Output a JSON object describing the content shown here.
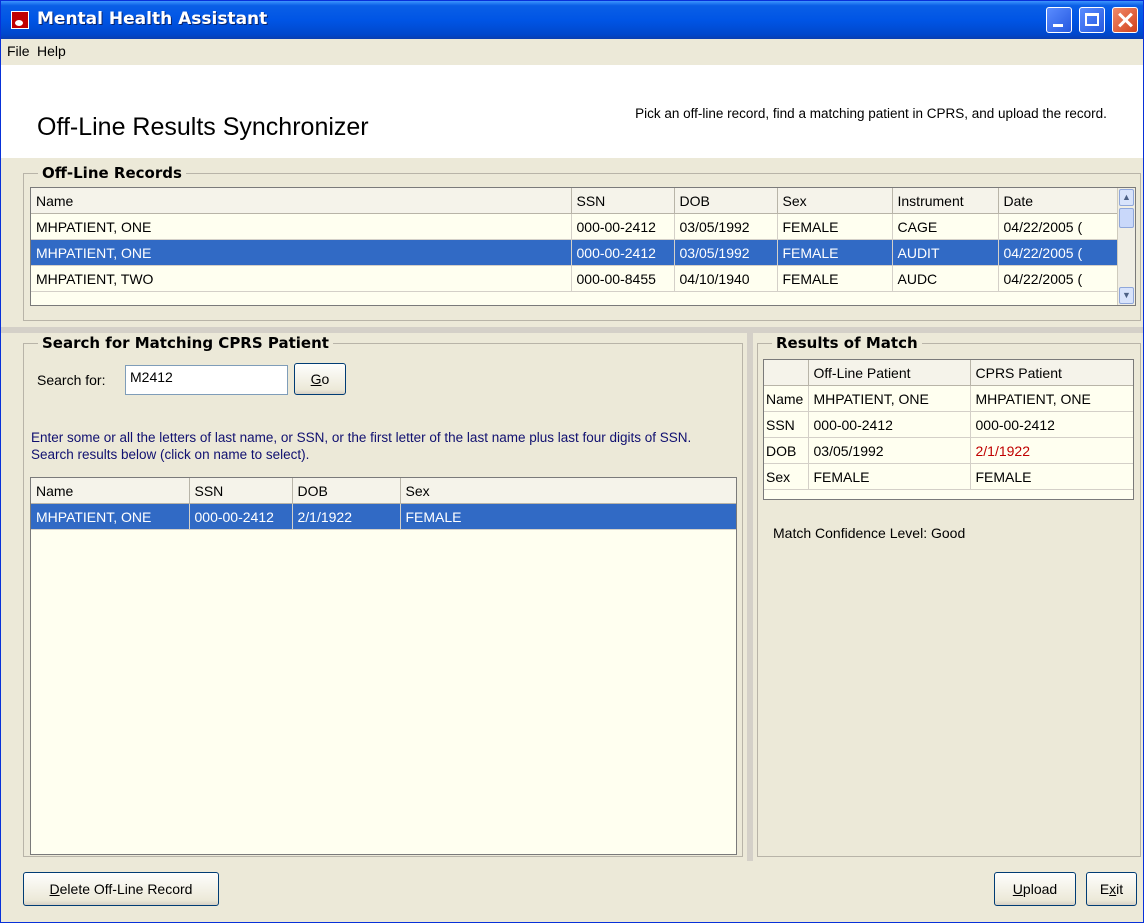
{
  "window": {
    "title": "Mental Health Assistant"
  },
  "menu": [
    "File",
    "Help"
  ],
  "header": {
    "title": "Off-Line Results Synchronizer",
    "instructions": "Pick an off-line record, find a matching patient in CPRS, and upload the record."
  },
  "offline": {
    "group_label": "Off-Line Records",
    "columns": [
      "Name",
      "SSN",
      "DOB",
      "Sex",
      "Instrument",
      "Date"
    ],
    "rows": [
      {
        "name": "MHPATIENT, ONE",
        "ssn": "000-00-2412",
        "dob": "03/05/1992",
        "sex": "FEMALE",
        "instrument": "CAGE",
        "date": "04/22/2005 ("
      },
      {
        "name": "MHPATIENT, ONE",
        "ssn": "000-00-2412",
        "dob": "03/05/1992",
        "sex": "FEMALE",
        "instrument": "AUDIT",
        "date": "04/22/2005 ("
      },
      {
        "name": "MHPATIENT, TWO",
        "ssn": "000-00-8455",
        "dob": "04/10/1940",
        "sex": "FEMALE",
        "instrument": "AUDC",
        "date": "04/22/2005 ("
      }
    ],
    "selected_index": 1
  },
  "search": {
    "group_label": "Search for Matching CPRS Patient",
    "label": "Search for:",
    "value": "M2412",
    "go_label": "Go",
    "go_hotkey": "G",
    "go_rest": "o",
    "help": "Enter some or all the letters of last name, or SSN, or the first letter of the last name plus last four digits of SSN. Search results below (click on name to select).",
    "columns": [
      "Name",
      "SSN",
      "DOB",
      "Sex"
    ],
    "results": [
      {
        "name": "MHPATIENT, ONE",
        "ssn": "000-00-2412",
        "dob": "2/1/1922",
        "sex": "FEMALE"
      }
    ]
  },
  "match": {
    "group_label": "Results of Match",
    "columns": [
      "",
      "Off-Line Patient",
      "CPRS Patient"
    ],
    "rows": [
      {
        "field": "Name",
        "offline": "MHPATIENT, ONE",
        "cprs": "MHPATIENT, ONE"
      },
      {
        "field": "SSN",
        "offline": "000-00-2412",
        "cprs": "000-00-2412"
      },
      {
        "field": "DOB",
        "offline": "03/05/1992",
        "cprs": "2/1/1922"
      },
      {
        "field": "Sex",
        "offline": "FEMALE",
        "cprs": "FEMALE"
      }
    ],
    "confidence_label": "Match Confidence Level:",
    "confidence_value": "Good",
    "mismatch_color": "#c00000"
  },
  "footer": {
    "delete": {
      "hotkey": "D",
      "rest": "elete Off-Line Record"
    },
    "upload": {
      "hotkey": "U",
      "rest": "pload"
    },
    "exit": {
      "pre": "E",
      "hotkey": "x",
      "rest": "it"
    }
  },
  "colors": {
    "selection": "#316ac5",
    "grid_bg": "#fffff0",
    "titlebar": "#0055e5"
  }
}
